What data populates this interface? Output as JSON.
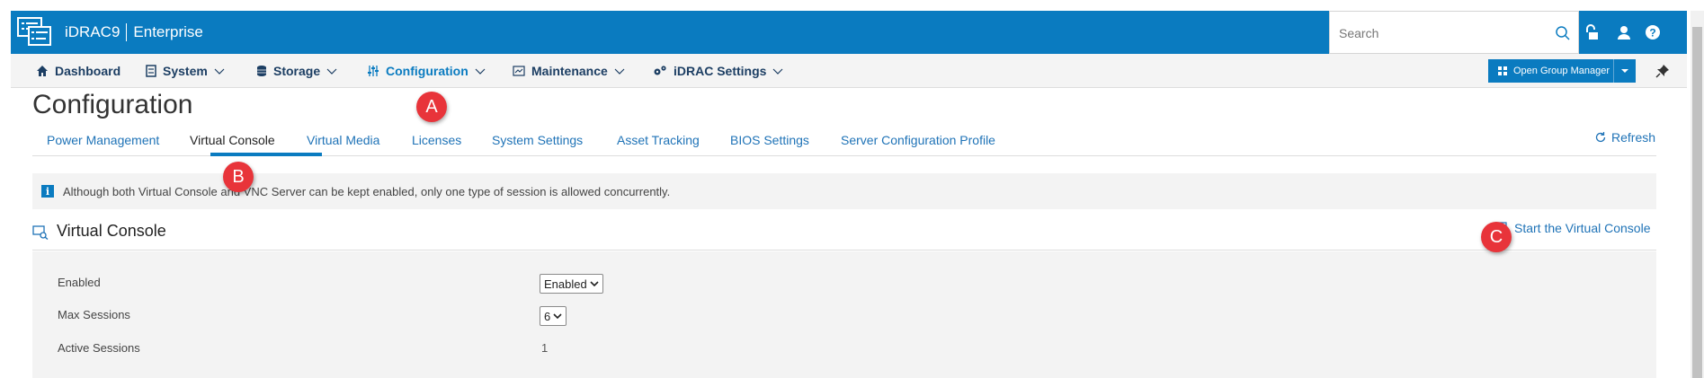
{
  "header": {
    "product": "iDRAC9",
    "edition": "Enterprise",
    "search_placeholder": "Search",
    "icons": [
      "logo-icon",
      "search-icon",
      "unlock-icon",
      "user-icon",
      "help-icon"
    ]
  },
  "nav": {
    "items": [
      {
        "label": "Dashboard",
        "icon": "home-icon",
        "has_menu": false
      },
      {
        "label": "System",
        "icon": "server-icon",
        "has_menu": true
      },
      {
        "label": "Storage",
        "icon": "database-icon",
        "has_menu": true
      },
      {
        "label": "Configuration",
        "icon": "sliders-icon",
        "has_menu": true,
        "active": true
      },
      {
        "label": "Maintenance",
        "icon": "maintenance-icon",
        "has_menu": true
      },
      {
        "label": "iDRAC Settings",
        "icon": "gears-icon",
        "has_menu": true
      }
    ],
    "group_manager_label": "Open Group Manager"
  },
  "page": {
    "title": "Configuration",
    "tabs": [
      {
        "label": "Power Management"
      },
      {
        "label": "Virtual Console",
        "active": true
      },
      {
        "label": "Virtual Media"
      },
      {
        "label": "Licenses"
      },
      {
        "label": "System Settings"
      },
      {
        "label": "Asset Tracking"
      },
      {
        "label": "BIOS Settings"
      },
      {
        "label": "Server Configuration Profile"
      }
    ],
    "refresh_label": "Refresh"
  },
  "banner": {
    "text": "Although both Virtual Console and VNC Server can be kept enabled, only one type of session is allowed concurrently."
  },
  "section": {
    "title": "Virtual Console",
    "start_label": "Start the Virtual Console",
    "fields": {
      "enabled": {
        "label": "Enabled",
        "value": "Enabled"
      },
      "max_sessions": {
        "label": "Max Sessions",
        "value": "6"
      },
      "active_sessions": {
        "label": "Active Sessions",
        "value": "1"
      }
    }
  },
  "callouts": {
    "a": "A",
    "b": "B",
    "c": "C"
  },
  "colors": {
    "brand_blue": "#0a7bc0",
    "link_blue": "#1f73b7",
    "callout_red": "#e8343a",
    "nav_text": "#1c3e63"
  }
}
